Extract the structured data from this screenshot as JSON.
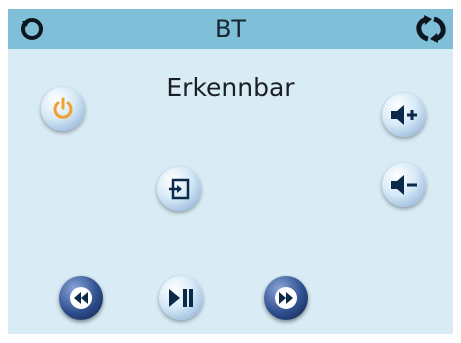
{
  "header": {
    "title": "BT",
    "back_icon": "rotate-ccw-icon",
    "sync_icon": "sync-arrows-icon"
  },
  "status": {
    "text": "Erkennbar"
  },
  "buttons": {
    "power": "power-icon",
    "input": "input-source-icon",
    "volume_up": "volume-up-icon",
    "volume_down": "volume-down-icon",
    "previous": "rewind-icon",
    "play_pause": "play-pause-icon",
    "next": "fast-forward-icon"
  },
  "colors": {
    "screen_bg": "#d9ecf5",
    "header_bg": "#7fbfd8",
    "accent_orange": "#f0a030",
    "icon_dark": "#0b2a4a"
  }
}
